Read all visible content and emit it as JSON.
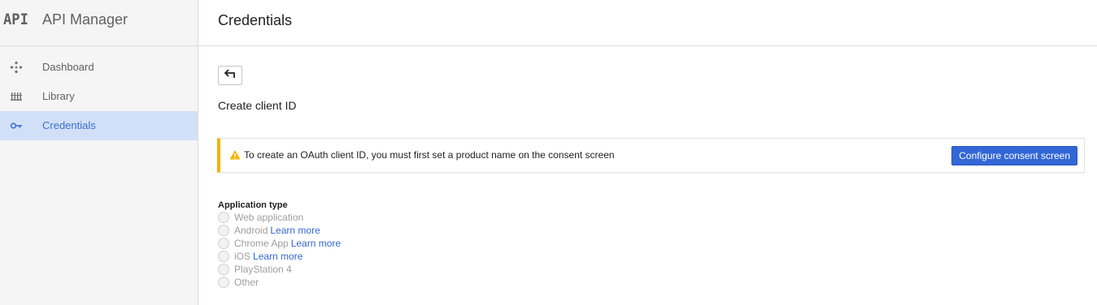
{
  "brand": {
    "logo": "API",
    "title": "API Manager"
  },
  "sidebar": {
    "items": [
      {
        "label": "Dashboard",
        "icon": "dashboard-icon"
      },
      {
        "label": "Library",
        "icon": "library-icon"
      },
      {
        "label": "Credentials",
        "icon": "key-icon",
        "active": true
      }
    ]
  },
  "header": {
    "title": "Credentials"
  },
  "main": {
    "back_icon": "back-arrow-icon",
    "subtitle": "Create client ID",
    "alert": {
      "icon": "warning-icon",
      "message": "To create an OAuth client ID, you must first set a product name on the consent screen",
      "button_label": "Configure consent screen"
    },
    "application_type": {
      "label": "Application type",
      "options": [
        {
          "label": "Web application",
          "link": ""
        },
        {
          "label": "Android",
          "link": "Learn more"
        },
        {
          "label": "Chrome App",
          "link": "Learn more"
        },
        {
          "label": "iOS",
          "link": "Learn more"
        },
        {
          "label": "PlayStation 4",
          "link": ""
        },
        {
          "label": "Other",
          "link": ""
        }
      ]
    }
  },
  "colors": {
    "accent": "#3367d6",
    "active_bg": "#d2e0f7",
    "warning": "#f4b400"
  }
}
